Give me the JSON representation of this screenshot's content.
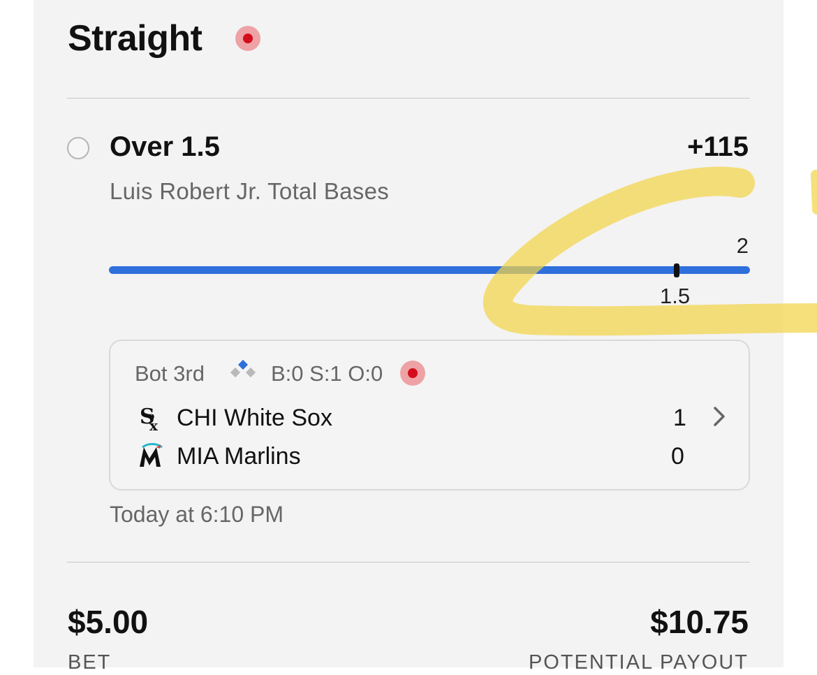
{
  "header": {
    "title": "Straight"
  },
  "bet": {
    "selection": "Over 1.5",
    "odds": "+115",
    "market": "Luis Robert Jr. Total Bases",
    "progress": {
      "current": "2",
      "line": "1.5",
      "current_value": 2,
      "line_value": 1.5,
      "max_value": 2
    }
  },
  "game": {
    "inning": "Bot 3rd",
    "count": "B:0 S:1 O:0",
    "bases_icon": "bases-diamond-icon",
    "teams": [
      {
        "name": "CHI White Sox",
        "score": "1",
        "logo_icon": "white-sox-logo-icon"
      },
      {
        "name": "MIA Marlins",
        "score": "0",
        "logo_icon": "marlins-logo-icon"
      }
    ],
    "time": "Today at 6:10 PM"
  },
  "footer": {
    "bet_amount": "$5.00",
    "bet_label": "BET",
    "payout_amount": "$10.75",
    "payout_label": "POTENTIAL PAYOUT"
  },
  "colors": {
    "progress_blue": "#2f6fdc",
    "live_red": "#d40d1b",
    "live_ring": "#eea2a5",
    "highlighter": "#f3d44a"
  }
}
